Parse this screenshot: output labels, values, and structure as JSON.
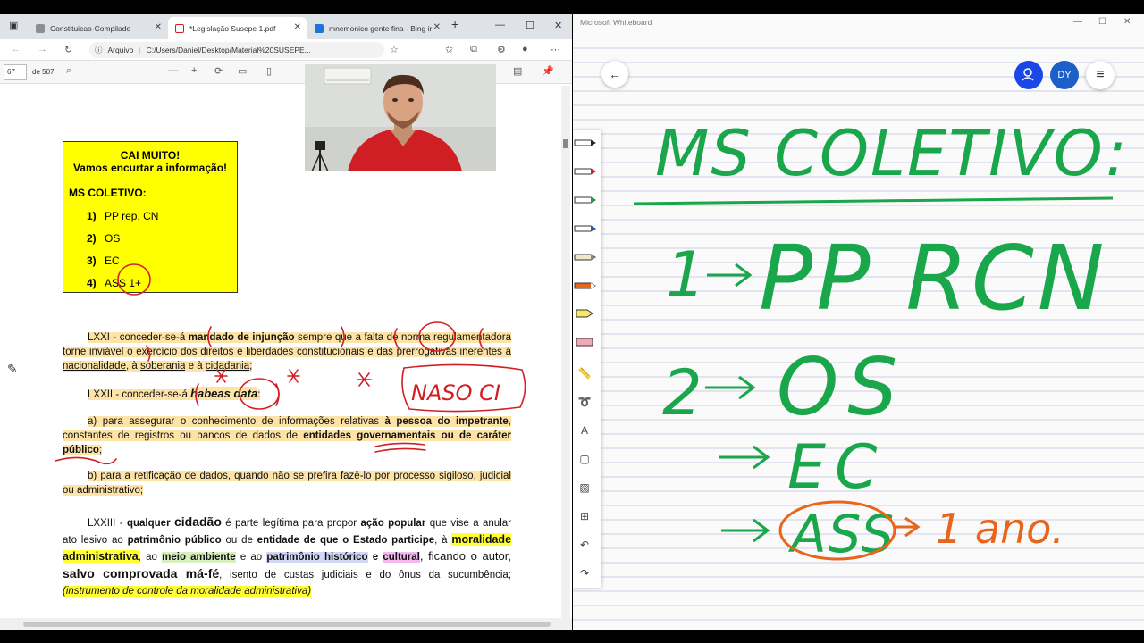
{
  "edge": {
    "tabs": [
      {
        "label": "Constituicao-Compilado",
        "close": "✕"
      },
      {
        "label": "*Legislação Susepe 1.pdf",
        "close": "✕"
      },
      {
        "label": "mnemonico gente fina - Bing ir",
        "close": "✕"
      }
    ],
    "new_tab": "+",
    "window_controls": {
      "minimize": "—",
      "maximize": "☐",
      "close": "✕"
    },
    "address": {
      "security_label": "Arquivo",
      "url": "C:/Users/Daniel/Desktop/Material%20SUSEPE..."
    },
    "pdf_toolbar": {
      "page_current": "67",
      "page_total": "de 507",
      "zoom_out": "—",
      "zoom_in": "+"
    }
  },
  "pdf": {
    "box": {
      "line1": "CAI MUITO!",
      "line2": "Vamos encurtar a informação!",
      "heading": "MS COLETIVO:",
      "items": [
        {
          "num": "1)",
          "text": "PP rep. CN"
        },
        {
          "num": "2)",
          "text": "OS"
        },
        {
          "num": "3)",
          "text": "EC"
        },
        {
          "num": "4)",
          "text": "ASS 1+"
        }
      ]
    },
    "lxxi": {
      "a": "LXXI - conceder-se-á ",
      "b": "mandado de injunção",
      "c": " sempre que a falta de norma regulamentadora torne inviável o exercício dos direitos e liberdades constitucionais e das prerrogativas inerentes à ",
      "d": "nacionalidade",
      "e": ", à ",
      "f": "soberania",
      "g": " e à ",
      "h": "cidadania",
      "i": ";"
    },
    "lxxii": {
      "a": "LXXII - conceder-se-á ",
      "b": "habeas data",
      "c": ":"
    },
    "item_a": {
      "a": "a) para assegurar o conhecimento de informações relativas ",
      "b": "à pessoa do impetrante",
      "c": ", constantes de registros ou bancos de dados de ",
      "d": "entidades governamentais ou de caráter público",
      "e": ";"
    },
    "item_b": "b) para a retificação de dados, quando não se prefira fazê-lo por processo sigiloso, judicial ou administrativo;",
    "lxxiii": {
      "a": "LXXIII - ",
      "b": "qualquer ",
      "c": "cidadão",
      "d": " é parte legítima para propor ",
      "e": "ação popular",
      "f": " que vise a anular ato lesivo ao ",
      "g": "patrimônio público",
      "h": " ou de ",
      "i": "entidade de que o Estado participe",
      "j": ", à ",
      "k": "moralidade administrativa",
      "l": ", ao ",
      "m": "meio ambiente",
      "n": " e ao ",
      "o": "patrimônio histórico",
      "p": " e ",
      "q": "cultural",
      "r": ", ficando o autor, ",
      "s": "salvo comprovada má-fé",
      "t": ", isento de custas judiciais e do ônus da sucumbência; ",
      "u": "(instrumento de controle da moralidade administrativa)"
    },
    "ink_note": "NASO CI"
  },
  "whiteboard": {
    "title": "Microsoft Whiteboard",
    "window_controls": {
      "minimize": "—",
      "maximize": "☐",
      "close": "✕"
    },
    "back": "←",
    "avatar_initials": "DY",
    "menu": "≡",
    "ink_text": {
      "heading": "MS COLETIVO:",
      "line1_num": "1",
      "line1_text": "PP RCN",
      "line2_num": "2",
      "line2_text": "OS",
      "line3_text": "EC",
      "line4_text": "ASS",
      "line4_note": "1 ano."
    },
    "colors": {
      "ink_green": "#1aa64a",
      "ink_orange": "#e8661c",
      "ink_red": "#d21f26",
      "accent_blue": "#1a47e6",
      "avatar_blue": "#1d5fc8"
    }
  }
}
